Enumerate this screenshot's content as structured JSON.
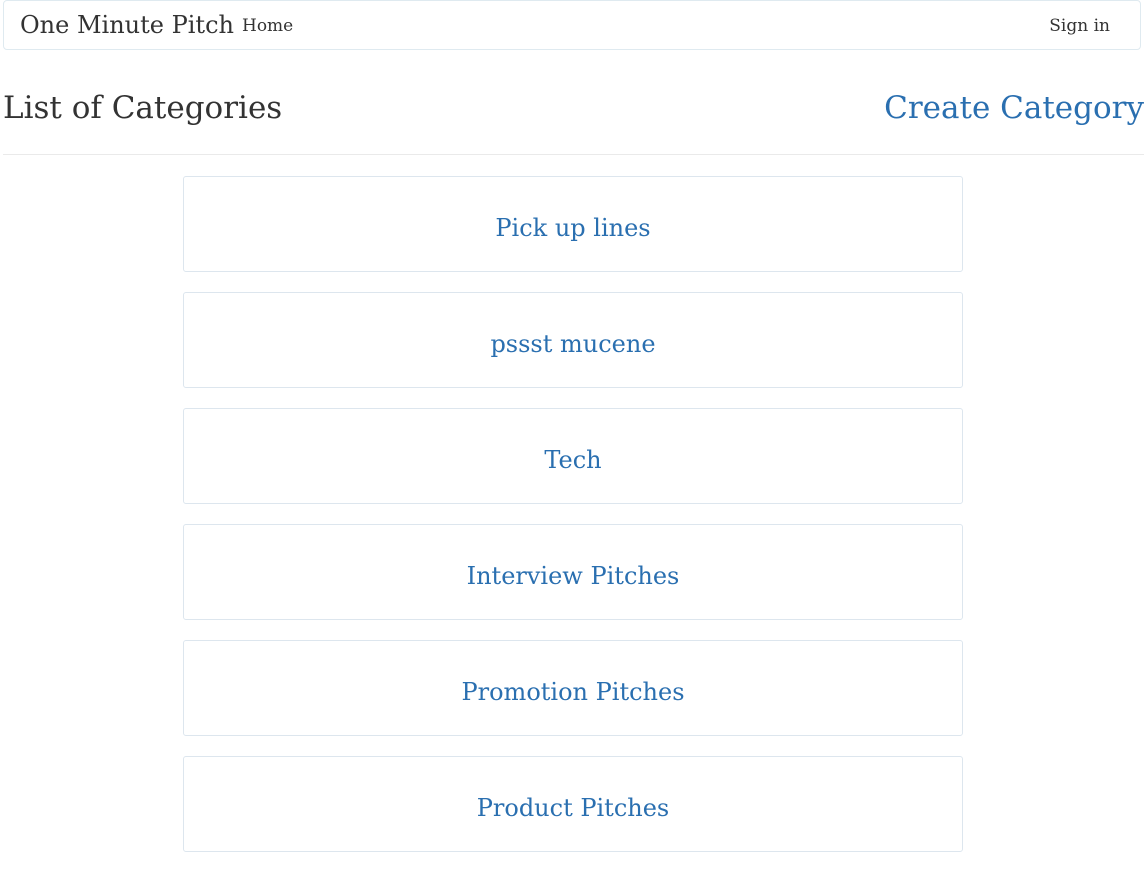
{
  "navbar": {
    "brand": "One Minute Pitch",
    "home_label": "Home",
    "signin_label": "Sign in"
  },
  "header": {
    "title": "List of Categories",
    "create_label": "Create Category"
  },
  "categories": [
    {
      "label": "Pick up lines"
    },
    {
      "label": "pssst mucene"
    },
    {
      "label": "Tech"
    },
    {
      "label": "Interview Pitches"
    },
    {
      "label": "Promotion Pitches"
    },
    {
      "label": "Product Pitches"
    }
  ],
  "colors": {
    "link": "#2a6fb0",
    "text": "#333333",
    "border": "#dde6ee"
  }
}
